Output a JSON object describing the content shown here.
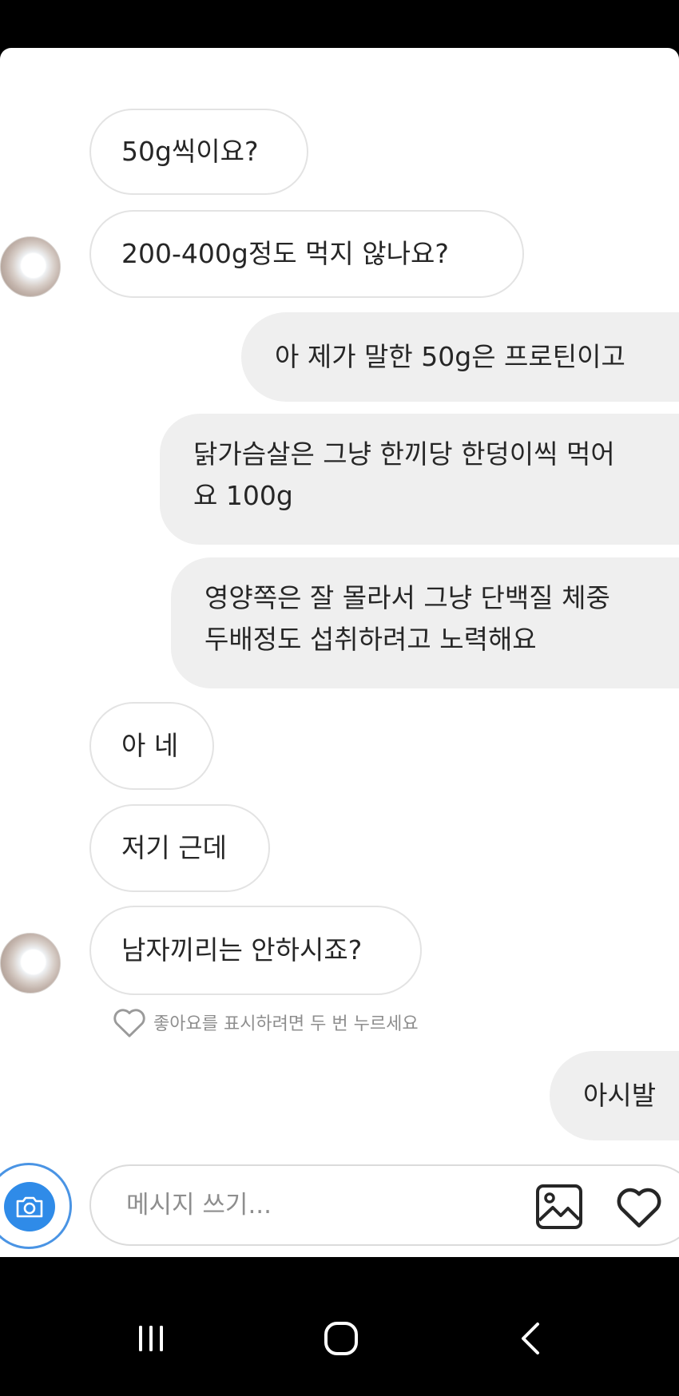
{
  "messages": [
    {
      "from": "them",
      "text": "50g씩이요?"
    },
    {
      "from": "them",
      "text": "200-400g정도 먹지 않나요?"
    },
    {
      "from": "me",
      "text": "아 제가 말한 50g은 프로틴이고"
    },
    {
      "from": "me",
      "lines": [
        "닭가슴살은 그냥 한끼당 한덩이씩 먹어",
        "요 100g"
      ]
    },
    {
      "from": "me",
      "lines": [
        "영양쪽은 잘 몰라서 그냥 단백질 체중",
        "두배정도 섭취하려고 노력해요"
      ]
    },
    {
      "from": "them",
      "text": "아 네"
    },
    {
      "from": "them",
      "text": "저기 근데"
    },
    {
      "from": "them",
      "text": "남자끼리는 안하시죠?"
    },
    {
      "from": "me",
      "text": "아시발"
    }
  ],
  "like_hint": "좋아요를 표시하려면 두 번 누르세요",
  "composer": {
    "placeholder": "메시지 쓰기...",
    "icons": [
      "camera-icon",
      "gallery-icon",
      "heart-icon"
    ]
  },
  "colors": {
    "outgoing_bubble": "#efefef",
    "incoming_border": "#e3e3e3",
    "camera_blue": "#2f8be8",
    "hint_gray": "#8e8e8e"
  },
  "system_nav": [
    "recents-icon",
    "home-icon",
    "back-icon"
  ]
}
